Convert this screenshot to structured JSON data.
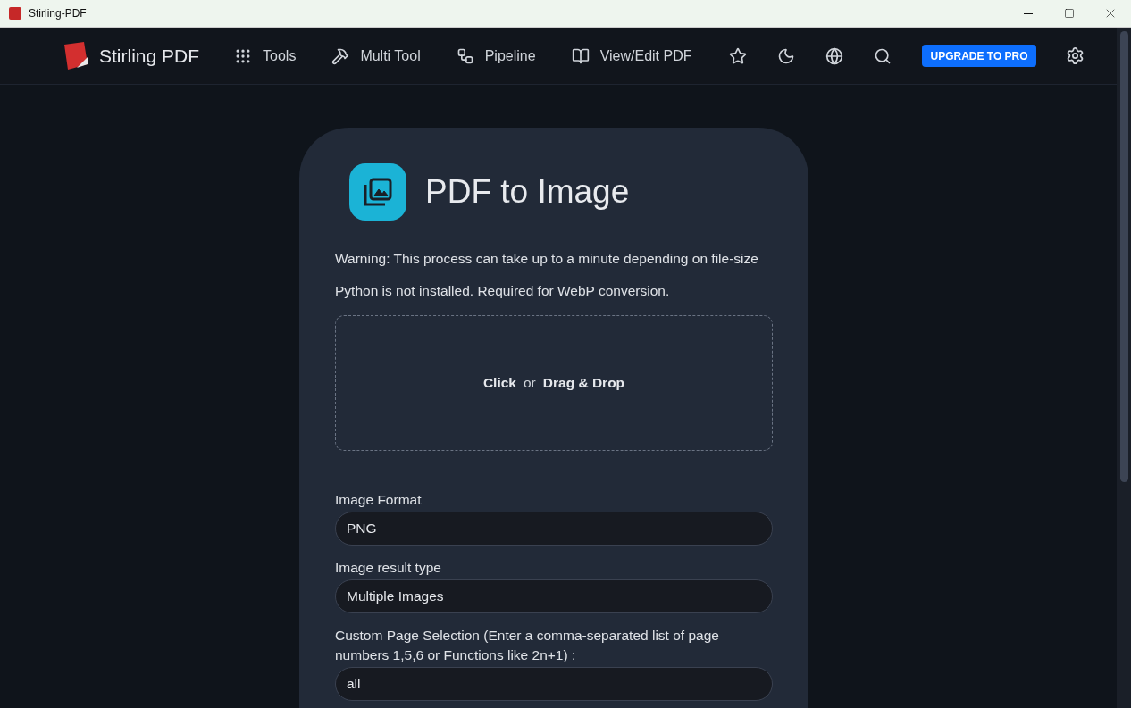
{
  "window": {
    "title": "Stirling-PDF"
  },
  "nav": {
    "brand": "Stirling PDF",
    "items": [
      {
        "label": "Tools"
      },
      {
        "label": "Multi Tool"
      },
      {
        "label": "Pipeline"
      },
      {
        "label": "View/Edit PDF"
      }
    ],
    "upgrade": "UPGRADE TO PRO"
  },
  "card": {
    "title": "PDF to Image",
    "notes": [
      "Warning: This process can take up to a minute depending on file-size",
      "Python is not installed. Required for WebP conversion."
    ],
    "dropzone": {
      "click": "Click",
      "or": "or",
      "drag": "Drag & Drop"
    },
    "fields": [
      {
        "label": "Image Format",
        "value": "PNG"
      },
      {
        "label": "Image result type",
        "value": "Multiple Images"
      },
      {
        "label": "Custom Page Selection (Enter a comma-separated list of page numbers 1,5,6 or Functions like 2n+1) :",
        "value": "all"
      }
    ]
  }
}
